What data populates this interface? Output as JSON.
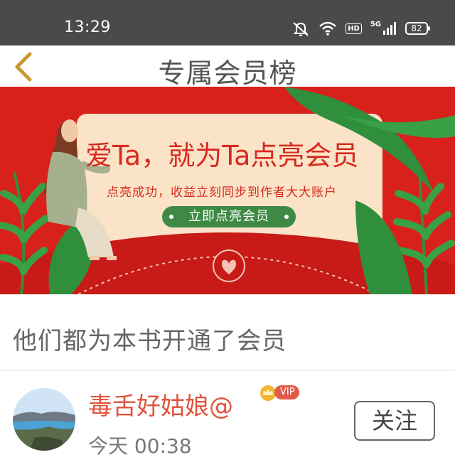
{
  "status_bar": {
    "time": "13:29",
    "icons": [
      "mute-icon",
      "wifi-icon",
      "hd-icon",
      "signal-5g-icon",
      "battery-icon"
    ],
    "hd_label": "HD",
    "network_label": "5G",
    "battery_level": "82"
  },
  "header": {
    "title": "专属会员榜",
    "back_icon": "chevron-left-icon"
  },
  "banner": {
    "headline": "爱Ta，就为Ta点亮会员",
    "subtitle": "点亮成功，收益立刻同步到作者大大账户",
    "cta_label": "立即点亮会员",
    "colors": {
      "background": "#d9211b",
      "card": "#fbe3c7",
      "cta": "#3e8a45"
    }
  },
  "section": {
    "heading": "他们都为本书开通了会员"
  },
  "members": [
    {
      "name": "毒舌好姑娘@",
      "badge": "VIP",
      "time": "今天 00:38",
      "follow_label": "关注"
    }
  ]
}
